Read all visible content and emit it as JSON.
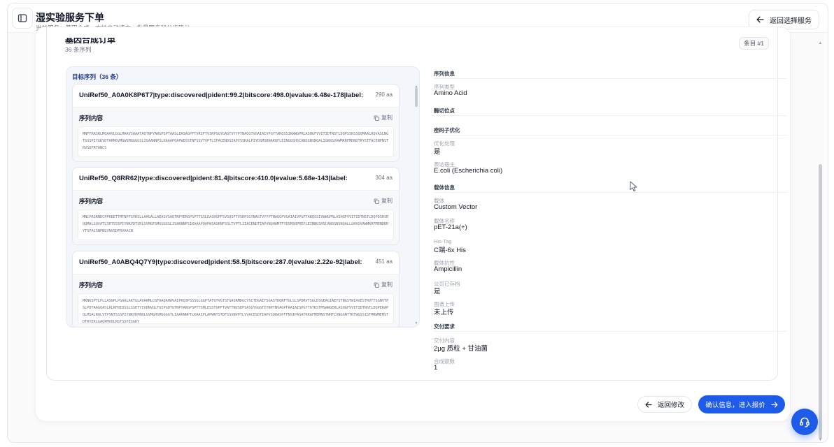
{
  "header": {
    "title": "湿实验服务下单",
    "subtitle": "当前服务：基因合成，支持自动填充、批量同步和分步确认",
    "back_service_label": "返回选择服务"
  },
  "summary": {
    "title": "基因合成订单",
    "count": "36 条序列",
    "item_badge": "条目 #1"
  },
  "sequences": {
    "header": "目标序列（36 条）",
    "content_label": "序列内容",
    "copy_label": "复制",
    "items": [
      {
        "id": "UniRef50_A0A0K8P6T7|type:discovered|pident:99.2|bitscore:498.0|evalue:6.48e-178|label:",
        "length": "290 aa",
        "sequence": "MNFFRASRLMQAAVLGGLMAAVSAAATAQTNPYARGPSPTAASLEASAGPFTVRSFTVSRPSGYGAGTVYYPTNAGGTVGAIAIVPGYTARQSSIKWWGPRLASHGFVVITIDTNSTLDQPSSRSSQQMAALRQVASLNGTSSSPIYGKVDTARMGVMGWSMGGGGSLISAANNPSLKAAAPQAPWDSSTNFSSVTVPTLIFACENDSIAPVSSHALPIYDSMSRNAKQFLEINGGSHSCANSGNSNQALIGKKGVAWMKRFMDNDTRYSTFACENPNSTRVSDFRTANCS"
      },
      {
        "id": "UniRef50_Q8RR62|type:discovered|pident:81.4|bitscore:410.0|evalue:5.68e-143|label:",
        "length": "304 aa",
        "sequence": "MNLPRSRNDCPPKEETTMTNPFSVRSLLAAGALLAEASVSAQTNPYERGPSPTTSSLEASRGPFSVSQSFTVSRPSGYNAGTVYYPTNAGGPVGAIAIVPGFTARQSSIVWWGPRLASHGFVVITIDTNSTLDQPDSRSRQQMALSQVATLSRTSSSPIYNKVDTSRLGVMGFSMGGGGSLISAKNNPSIKAAAPQAPWSASKNFSSLTVPTLIIACENDTIAPVNQHAMTFYDSMSRPREFLEINNGSHSCANSGNSNQALLGKKGVAWMKRFMDNDRRYTSFACSNPNSYNVSDFRVAACN"
      },
      {
        "id": "UniRef50_A0ABQ4Q7Y9|type:discovered|pident:58.5|bitscore:287.0|evalue:2.22e-92|label:",
        "length": "451 aa",
        "sequence": "MKNKSPTLPLLASGPLPGAALAKTGLAVAAMLCGFAAQAHAVAIPKQSPSSSGLGGPTATGTVGTSTGASRMDGCYSCTDGAITSGASTDQNFTGLSLSPDRVTSGLDSGEAGIAEYSTNGSTWIAVESTRVTTSGNVTPSLPDTAAGQASLRLRFRIDSSLSSETYIVDNVQLTGIPGDTGTNPYARGPSPTTSMLESSTGPFTVATTNVSEPSASGYGGGTIYNPTNVAGPFAAIAISPGYTGTKSTMSWWGERLASHGFVVITIDTNSTLDQPERAPQLMSALRQLVTPSNTSSSPIYNKVDPNRLGVMGHSMGGGGTLIAAKNNPTLKAAIPLAPWNTSTDFSSVNVPTLVVACESDTIAPVSQHASPFFNSIPASATKKAFMEMNSTNHFCVNGGNTTRTWGSSISTMRWMEMSTDTRYEKLGAQPMVDLNSTSSYESGKY"
      }
    ]
  },
  "info": {
    "sections": {
      "seq_info": "序列信息",
      "cut_site": "酶切位点",
      "codon_opt": "密码子优化",
      "vector_info": "载体信息",
      "delivery": "交付要求"
    },
    "fields": [
      {
        "label": "序列类型",
        "value": "Amino Acid"
      },
      {
        "label": "优化处理",
        "value": "是"
      },
      {
        "label": "表达宿主",
        "value": "E.coli (Escherichia coli)"
      },
      {
        "label": "载体",
        "value": "Custom Vector"
      },
      {
        "label": "载体名称",
        "value": "pET-21a(+)"
      },
      {
        "label": "His-Tag",
        "value": "C端-6x His"
      },
      {
        "label": "载体抗性",
        "value": "Ampicillin"
      },
      {
        "label": "公司已存档",
        "value": "是"
      },
      {
        "label": "图谱上传",
        "value": "未上传"
      },
      {
        "label": "交付内容",
        "value": "2μg 质粒 + 甘油菌"
      },
      {
        "label": "合成管数",
        "value": "1"
      }
    ]
  },
  "footer": {
    "back_label": "返回修改",
    "confirm_label": "确认信息，进入报价"
  },
  "colors": {
    "primary": "#1d5be8",
    "section_header": "#1e3a8a"
  },
  "icons": [
    "sidebar-icon",
    "arrow-left-icon",
    "copy-icon",
    "arrow-right-icon",
    "headset-icon",
    "mouse-cursor-icon"
  ]
}
